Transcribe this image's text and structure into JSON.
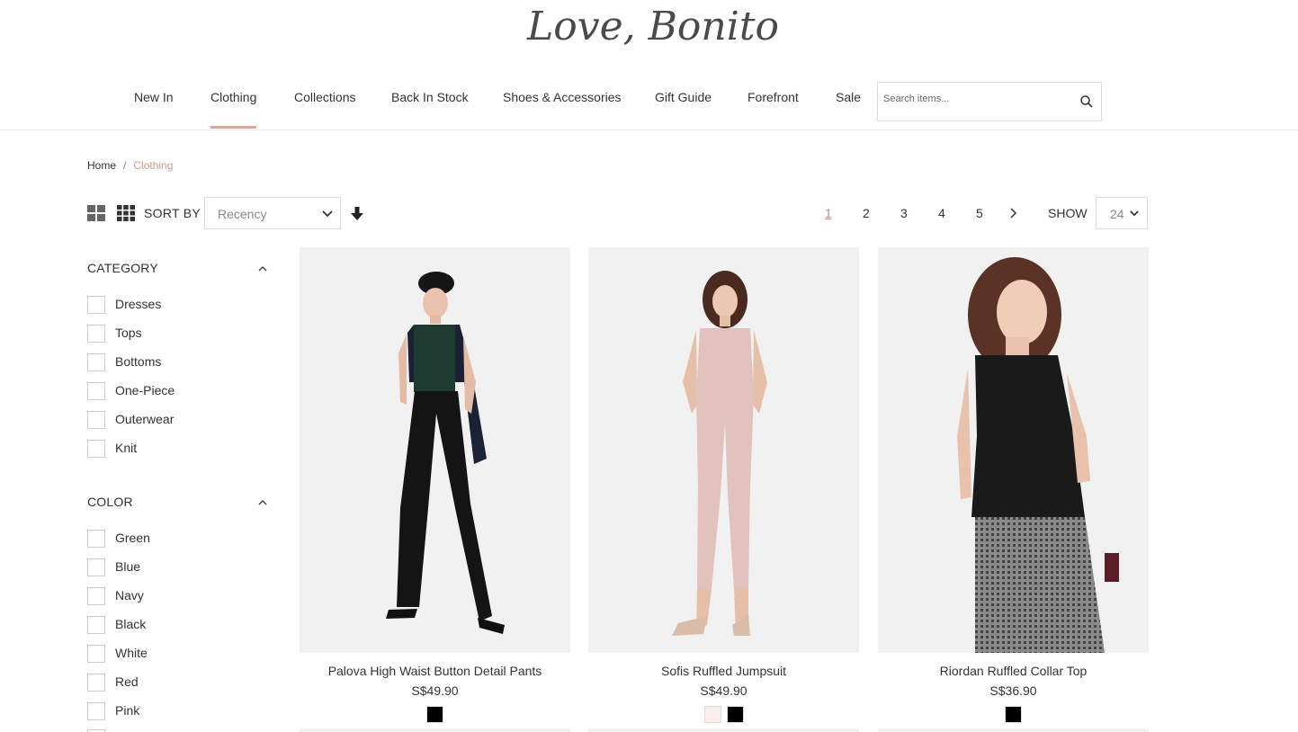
{
  "brand": {
    "logo_text": "Love, Bonito"
  },
  "nav": {
    "items": [
      {
        "label": "New In"
      },
      {
        "label": "Clothing"
      },
      {
        "label": "Collections"
      },
      {
        "label": "Back In Stock"
      },
      {
        "label": "Shoes & Accessories"
      },
      {
        "label": "Gift Guide"
      },
      {
        "label": "Forefront"
      },
      {
        "label": "Sale"
      }
    ],
    "active": "Clothing"
  },
  "search": {
    "placeholder": "Search items...",
    "value": "",
    "icon": "search-icon"
  },
  "breadcrumb": {
    "home": "Home",
    "separator": "/",
    "current": "Clothing"
  },
  "toolbar": {
    "sort_label": "SORT BY",
    "sort_value": "Recency",
    "pages": [
      "1",
      "2",
      "3",
      "4",
      "5"
    ],
    "current_page": "1",
    "show_label": "SHOW",
    "show_value": "24"
  },
  "filters": {
    "category": {
      "title": "CATEGORY",
      "items": [
        "Dresses",
        "Tops",
        "Bottoms",
        "One-Piece",
        "Outerwear",
        "Knit"
      ]
    },
    "color": {
      "title": "COLOR",
      "items": [
        "Green",
        "Blue",
        "Navy",
        "Black",
        "White",
        "Red",
        "Pink"
      ]
    }
  },
  "products": [
    {
      "name": "Palova High Waist Button Detail Pants",
      "price": "S$49.90",
      "swatches": [
        "#000000"
      ]
    },
    {
      "name": "Sofis Ruffled Jumpsuit",
      "price": "S$49.90",
      "swatches": [
        "#fbeeee",
        "#000000"
      ]
    },
    {
      "name": "Riordan Ruffled Collar Top",
      "price": "S$36.90",
      "swatches": [
        "#000000"
      ]
    }
  ],
  "colors": {
    "accent": "#d7a79b",
    "active_text": "#c58a7a",
    "image_bg": "#f1f1f1"
  }
}
